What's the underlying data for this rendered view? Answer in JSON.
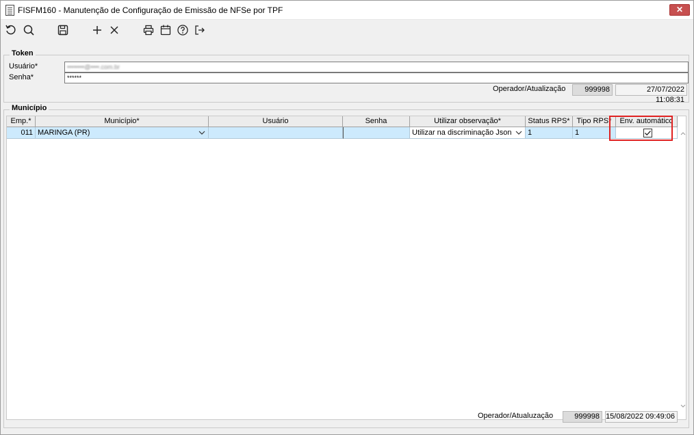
{
  "window": {
    "title": "FISFM160 - Manutenção de Configuração de Emissão de NFSe por TPF",
    "close_label": "✕"
  },
  "toolbar": {
    "buttons": [
      {
        "name": "undo-icon"
      },
      {
        "name": "search-icon"
      },
      {
        "name": "save-icon"
      },
      {
        "name": "add-icon"
      },
      {
        "name": "delete-icon"
      },
      {
        "name": "print-icon"
      },
      {
        "name": "calendar-icon"
      },
      {
        "name": "help-icon"
      },
      {
        "name": "exit-icon"
      }
    ]
  },
  "token": {
    "legend": "Token",
    "usuario_label": "Usuário*",
    "usuario_value": "••••••••@••••.com.br",
    "senha_label": "Senha*",
    "senha_value": "******",
    "operador_label": "Operador/Atualização",
    "operador_code": "999998",
    "operador_date": "27/07/2022 11:08:31"
  },
  "municipio": {
    "legend": "Município",
    "columns": [
      "Emp.*",
      "Município*",
      "Usuário",
      "Senha",
      "Utilizar observação*",
      "Status RPS*",
      "Tipo RPS*",
      "Env. automático"
    ],
    "rows": [
      {
        "emp": "011",
        "municipio": "MARINGA (PR)",
        "usuario": "",
        "senha": "",
        "observacao": "Utilizar na discriminação Json",
        "status_rps": "1",
        "tipo_rps": "1",
        "env_automatico": true
      }
    ],
    "operador_label": "Operador/Atualuzação",
    "operador_code": "999998",
    "operador_date": "15/08/2022 09:49:06"
  },
  "colors": {
    "selected_row": "#cdeafd",
    "highlight": "#e02020",
    "close_button": "#c75050"
  }
}
